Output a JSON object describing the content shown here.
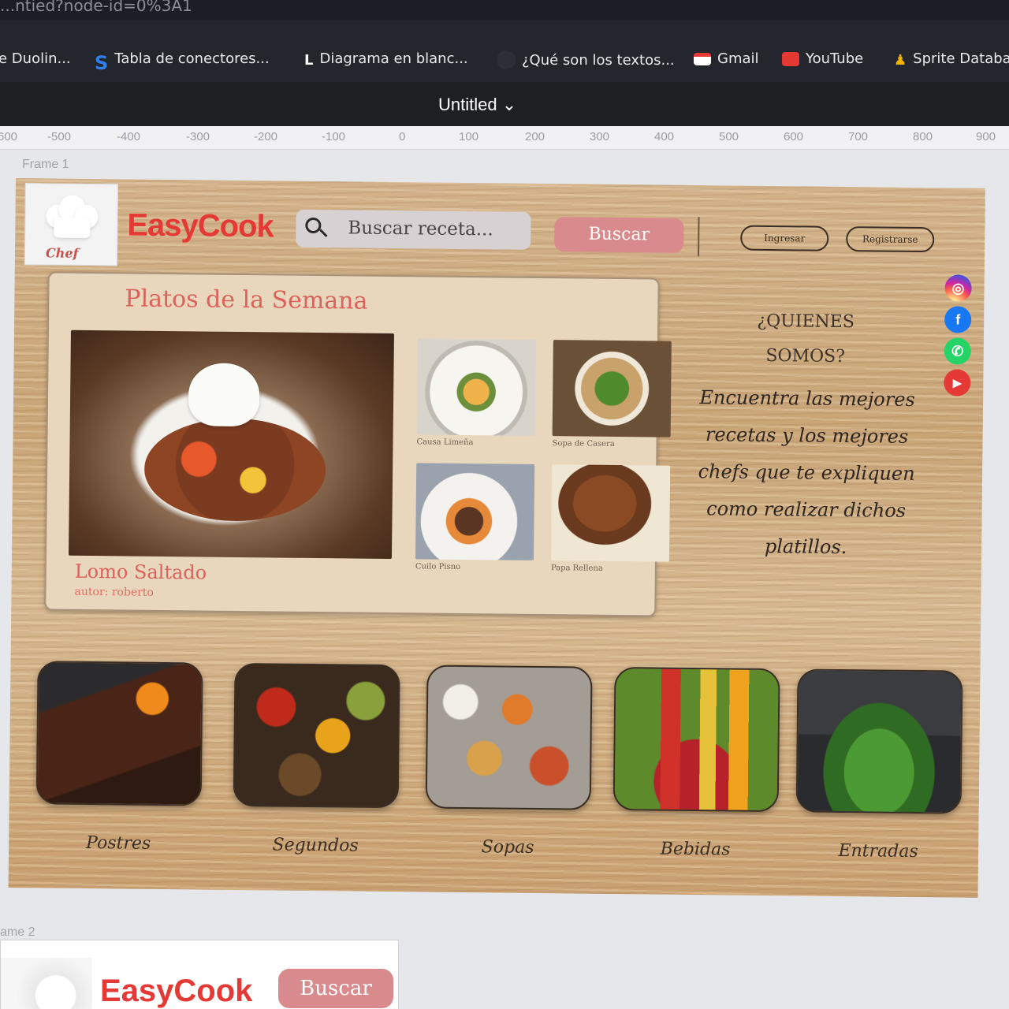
{
  "browser": {
    "url_fragment": "...ntied?node-id=0%3A1",
    "bookmarks": [
      {
        "label": "e Duolin...",
        "icon": "duolingo-icon"
      },
      {
        "label": "Tabla de conectores...",
        "icon": "s-icon"
      },
      {
        "label": "Diagrama en blanc...",
        "icon": "lucid-icon"
      },
      {
        "label": "¿Qué son los textos...",
        "icon": "globe-icon"
      },
      {
        "label": "Gmail",
        "icon": "gmail-icon"
      },
      {
        "label": "YouTube",
        "icon": "youtube-icon"
      },
      {
        "label": "Sprite Databa",
        "icon": "sprite-icon"
      }
    ]
  },
  "editor": {
    "file_title": "Untitled ⌄",
    "ruler_ticks": [
      "-600",
      "-500",
      "-400",
      "-300",
      "-200",
      "-100",
      "0",
      "100",
      "200",
      "300",
      "400",
      "500",
      "600",
      "700",
      "800",
      "900"
    ],
    "frame1_label": "Frame 1",
    "frame2_label": "ame 2"
  },
  "site": {
    "logo_text": "Chef",
    "brand": "EasyCook",
    "search_placeholder": "Buscar receta...",
    "search_button": "Buscar",
    "login_button": "Ingresar",
    "register_button": "Registrarse",
    "social": [
      {
        "name": "instagram-icon",
        "color": "#e1306c",
        "glyph": "◎"
      },
      {
        "name": "facebook-icon",
        "color": "#1877f2",
        "glyph": "f"
      },
      {
        "name": "whatsapp-icon",
        "color": "#25d366",
        "glyph": "✆"
      },
      {
        "name": "youtube-icon",
        "color": "#e53935",
        "glyph": "▶"
      }
    ],
    "weekly": {
      "title": "Platos de la Semana",
      "main_dish": "Lomo Saltado",
      "main_author": "autor: roberto",
      "thumbs": [
        {
          "caption": "Causa Limeña"
        },
        {
          "caption": "Sopa de Casera"
        },
        {
          "caption": "Cuilo Pisno"
        },
        {
          "caption": "Papa Rellena"
        }
      ]
    },
    "about": {
      "title_line1": "¿QUIENES",
      "title_line2": "SOMOS?",
      "text": "Encuentra las mejores recetas y los mejores chefs que te expliquen como realizar dichos platillos."
    },
    "categories": [
      {
        "label": "Postres"
      },
      {
        "label": "Segundos"
      },
      {
        "label": "Sopas"
      },
      {
        "label": "Bebidas"
      },
      {
        "label": "Entradas"
      }
    ]
  },
  "frame2": {
    "brand": "EasyCook",
    "button": "Buscar"
  }
}
